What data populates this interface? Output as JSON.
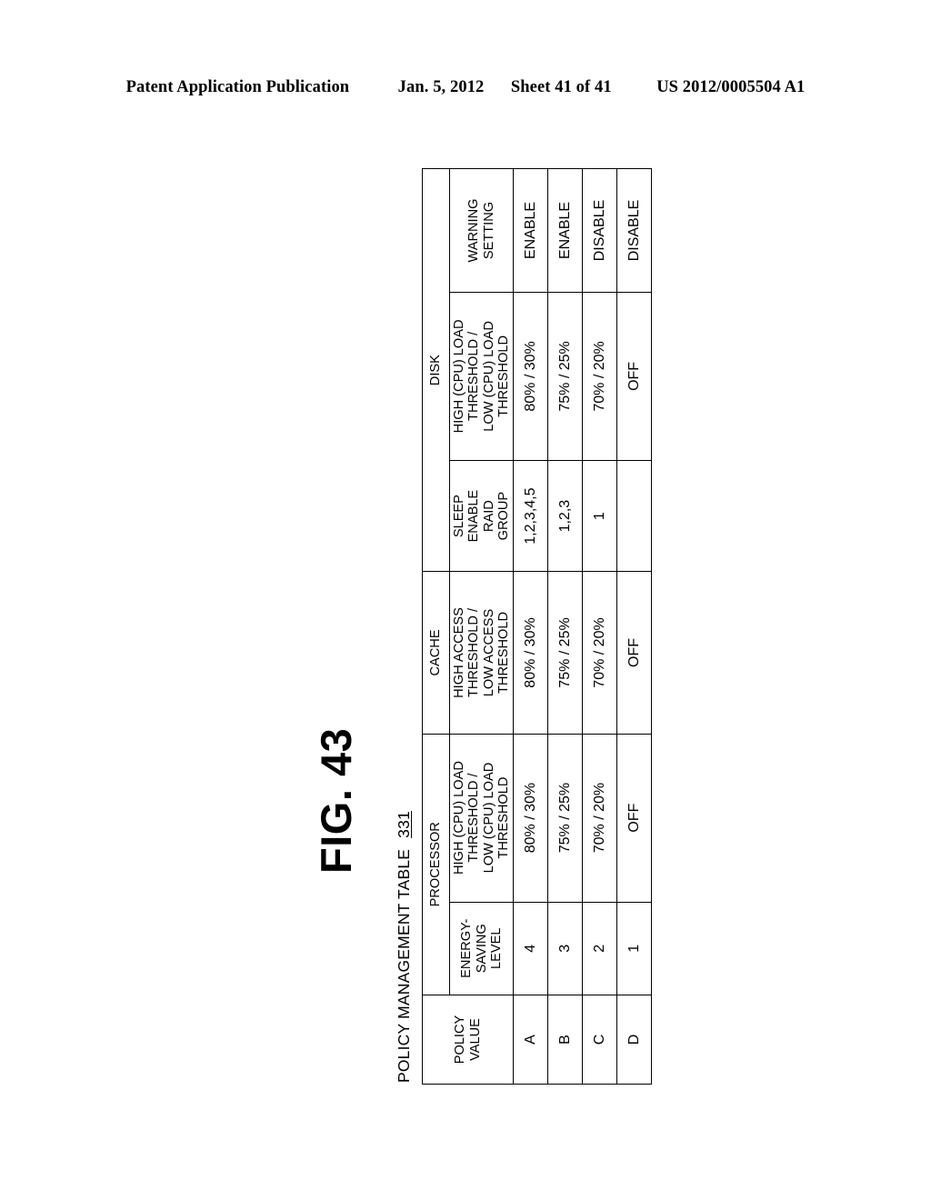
{
  "page_header": {
    "publication": "Patent Application Publication",
    "date": "Jan. 5, 2012",
    "sheet": "Sheet 41 of 41",
    "patent_number": "US 2012/0005504 A1"
  },
  "figure": {
    "label": "FIG. 43",
    "caption": "POLICY MANAGEMENT TABLE",
    "reference_numeral": "331"
  },
  "table": {
    "group_headers": [
      {
        "label": "POLICY VALUE",
        "span": 1
      },
      {
        "label": "PROCESSOR",
        "span": 2
      },
      {
        "label": "CACHE",
        "span": 1
      },
      {
        "label": "DISK",
        "span": 3
      }
    ],
    "sub_headers": [
      "ENERGY-\nSAVING\nLEVEL",
      "HIGH (CPU) LOAD\nTHRESHOLD /\nLOW (CPU) LOAD\nTHRESHOLD",
      "HIGH ACCESS\nTHRESHOLD /\nLOW ACCESS\nTHRESHOLD",
      "SLEEP\nENABLE\nRAID\nGROUP",
      "HIGH (CPU) LOAD\nTHRESHOLD /\nLOW (CPU) LOAD\nTHRESHOLD",
      "WARNING\nSETTING"
    ],
    "rows": [
      {
        "policy_value": "A",
        "energy_saving_level": "4",
        "processor_threshold": "80% / 30%",
        "cache_threshold": "80% / 30%",
        "sleep_enable_raid_group": "1,2,3,4,5",
        "disk_threshold": "80% / 30%",
        "warning_setting": "ENABLE"
      },
      {
        "policy_value": "B",
        "energy_saving_level": "3",
        "processor_threshold": "75% / 25%",
        "cache_threshold": "75% / 25%",
        "sleep_enable_raid_group": "1,2,3",
        "disk_threshold": "75% / 25%",
        "warning_setting": "ENABLE"
      },
      {
        "policy_value": "C",
        "energy_saving_level": "2",
        "processor_threshold": "70% / 20%",
        "cache_threshold": "70% / 20%",
        "sleep_enable_raid_group": "1",
        "disk_threshold": "70% / 20%",
        "warning_setting": "DISABLE"
      },
      {
        "policy_value": "D",
        "energy_saving_level": "1",
        "processor_threshold": "OFF",
        "cache_threshold": "OFF",
        "sleep_enable_raid_group": "",
        "disk_threshold": "OFF",
        "warning_setting": "DISABLE"
      }
    ]
  },
  "colors": {
    "ink": "#000000",
    "paper": "#ffffff"
  }
}
